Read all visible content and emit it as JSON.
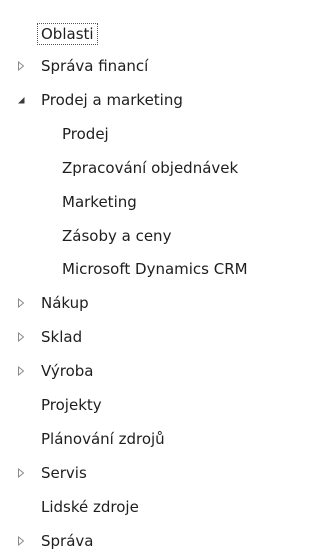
{
  "tree": {
    "root": "Oblasti",
    "items": [
      {
        "label": "Správa financí",
        "expander": "collapsed",
        "level": 1
      },
      {
        "label": "Prodej a marketing",
        "expander": "expanded",
        "level": 1
      },
      {
        "label": "Prodej",
        "expander": "none",
        "level": 2
      },
      {
        "label": "Zpracování objednávek",
        "expander": "none",
        "level": 2
      },
      {
        "label": "Marketing",
        "expander": "none",
        "level": 2
      },
      {
        "label": "Zásoby a ceny",
        "expander": "none",
        "level": 2
      },
      {
        "label": "Microsoft Dynamics CRM",
        "expander": "none",
        "level": 2
      },
      {
        "label": "Nákup",
        "expander": "collapsed",
        "level": 1
      },
      {
        "label": "Sklad",
        "expander": "collapsed",
        "level": 1
      },
      {
        "label": "Výroba",
        "expander": "collapsed",
        "level": 1
      },
      {
        "label": "Projekty",
        "expander": "none",
        "level": 1
      },
      {
        "label": "Plánování zdrojů",
        "expander": "none",
        "level": 1
      },
      {
        "label": "Servis",
        "expander": "collapsed",
        "level": 1
      },
      {
        "label": "Lidské zdroje",
        "expander": "none",
        "level": 1
      },
      {
        "label": "Správa",
        "expander": "collapsed",
        "level": 1
      }
    ],
    "colors": {
      "text": "#1e1e1e",
      "arrow_collapsed": "#8a8a8a",
      "arrow_expanded": "#3c3c3c"
    }
  }
}
